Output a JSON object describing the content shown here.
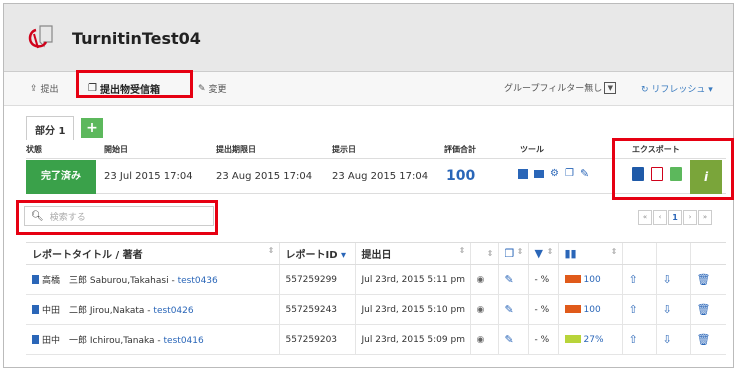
{
  "app": {
    "title": "TurnitinTest04"
  },
  "toolbar": {
    "submit": "提出",
    "inbox": "提出物受信箱",
    "edit": "変更",
    "group_filter": "グループフィルター無し",
    "refresh": "リフレッシュ ▾"
  },
  "part": {
    "tab": "部分 1",
    "add": "+"
  },
  "labels": {
    "status": "状態",
    "start": "開始日",
    "due": "提出期限日",
    "post": "提示日",
    "grade_total": "評価合計",
    "tools": "ツール",
    "export": "エクスポート"
  },
  "info": {
    "status_btn": "完了済み",
    "start": "23 Jul 2015 17:04",
    "due": "23 Aug 2015 17:04",
    "post": "23 Aug 2015 17:04",
    "grade": "100",
    "info_btn": "i"
  },
  "search": {
    "placeholder": "検索する"
  },
  "pager": {
    "first": "«",
    "prev": "‹",
    "current": "1",
    "next": "›",
    "last": "»"
  },
  "table": {
    "headers": {
      "title": "レポートタイトル / 著者",
      "id": "レポートID",
      "date": "提出日"
    },
    "rows": [
      {
        "title": "高橋　三郎 Saburou,Takahasi - ",
        "link": "test0436",
        "id": "557259299",
        "date": "Jul 23rd, 2015 5:11 pm",
        "pct": "- %",
        "sim": "100",
        "sim_color": "#e05a1a"
      },
      {
        "title": "中田　二郎 Jirou,Nakata - ",
        "link": "test0426",
        "id": "557259243",
        "date": "Jul 23rd, 2015 5:10 pm",
        "pct": "- %",
        "sim": "100",
        "sim_color": "#e05a1a"
      },
      {
        "title": "田中　一郎 Ichirou,Tanaka - ",
        "link": "test0416",
        "id": "557259203",
        "date": "Jul 23rd, 2015 5:09 pm",
        "pct": "- %",
        "sim": "27%",
        "sim_color": "#b8d43a"
      }
    ]
  }
}
